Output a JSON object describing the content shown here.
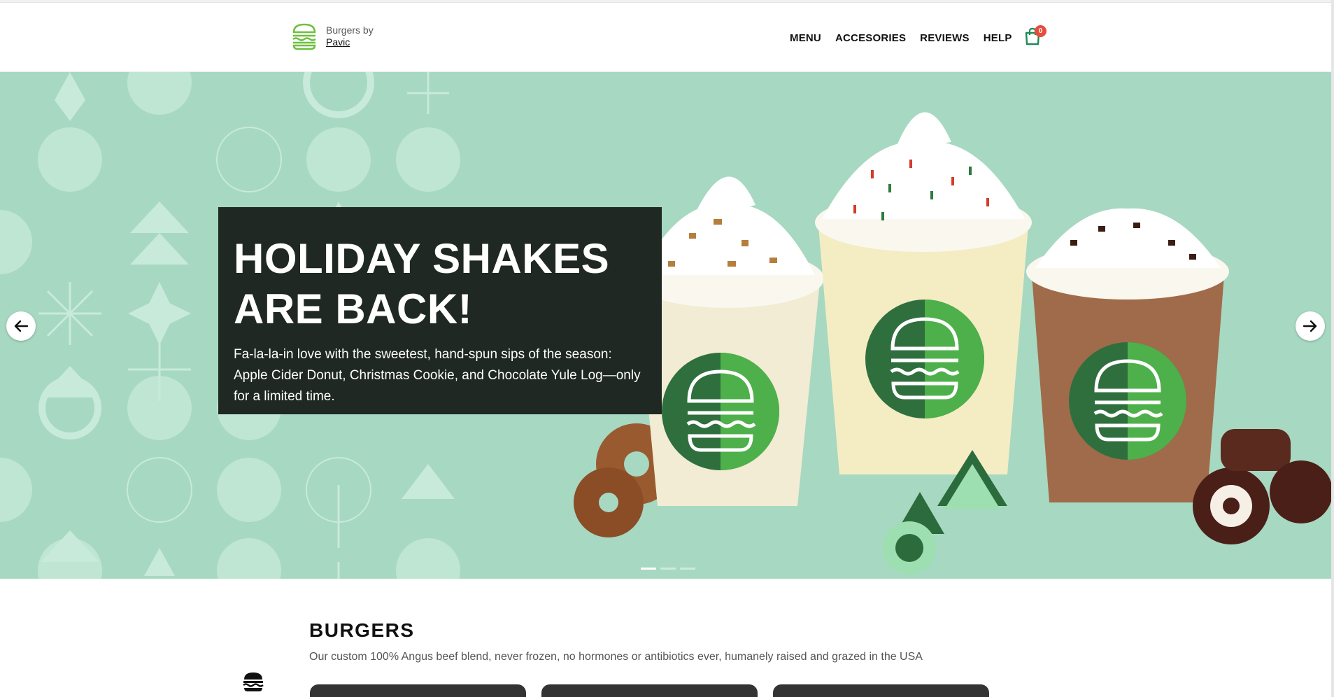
{
  "header": {
    "brand_prefix": "Burgers by",
    "brand_author": "Pavic",
    "nav": [
      "MENU",
      "ACCESORIES",
      "REVIEWS",
      "HELP"
    ],
    "cart_count": "0"
  },
  "hero": {
    "title": "HOLIDAY SHAKES ARE BACK!",
    "text": "Fa-la-la-in love with the sweetest, hand-spun sips of the season: Apple Cider Donut, Christmas Cookie, and Chocolate Yule Log—only for a limited time.",
    "prev_icon": "arrow-left-icon",
    "next_icon": "arrow-right-icon",
    "slides": 3,
    "active_slide": 1
  },
  "section": {
    "title": "BURGERS",
    "description": "Our custom 100% Angus beef blend, never frozen, no hormones or antibiotics ever, humanely raised and grazed in the USA"
  },
  "colors": {
    "brand_green": "#6dbf3f",
    "hero_bg": "#a7d8c2",
    "card_bg": "#1f2823",
    "badge": "#e74c3c"
  }
}
